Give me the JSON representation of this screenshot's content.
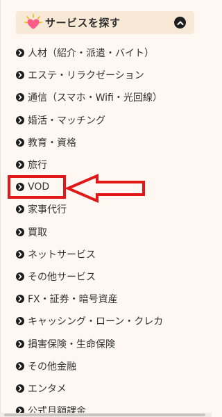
{
  "header": {
    "title": "サービスを探す",
    "heart_icon": "heart-sparkle-icon",
    "toggle_icon": "chevron-up-icon"
  },
  "items": [
    {
      "label": "人材（紹介・派遣・バイト）"
    },
    {
      "label": "エステ・リラクゼーション"
    },
    {
      "label": "通信（スマホ・Wifi・光回線）"
    },
    {
      "label": "婚活・マッチング"
    },
    {
      "label": "教育・資格"
    },
    {
      "label": "旅行"
    },
    {
      "label": "VOD"
    },
    {
      "label": "家事代行"
    },
    {
      "label": "買取"
    },
    {
      "label": "ネットサービス"
    },
    {
      "label": "その他サービス"
    },
    {
      "label": "FX・証券・暗号資産"
    },
    {
      "label": "キャッシング・ローン・クレカ"
    },
    {
      "label": "損害保険・生命保険"
    },
    {
      "label": "その他金融"
    },
    {
      "label": "エンタメ"
    },
    {
      "label": "公式月額課金"
    }
  ],
  "annotation": {
    "highlight_color": "#e01818",
    "target": "VOD"
  },
  "colors": {
    "background": "#fff8f2",
    "header_bg": "#f7e9d6",
    "heart": "#ff5c8a",
    "bullet": "#1e1e1e"
  }
}
